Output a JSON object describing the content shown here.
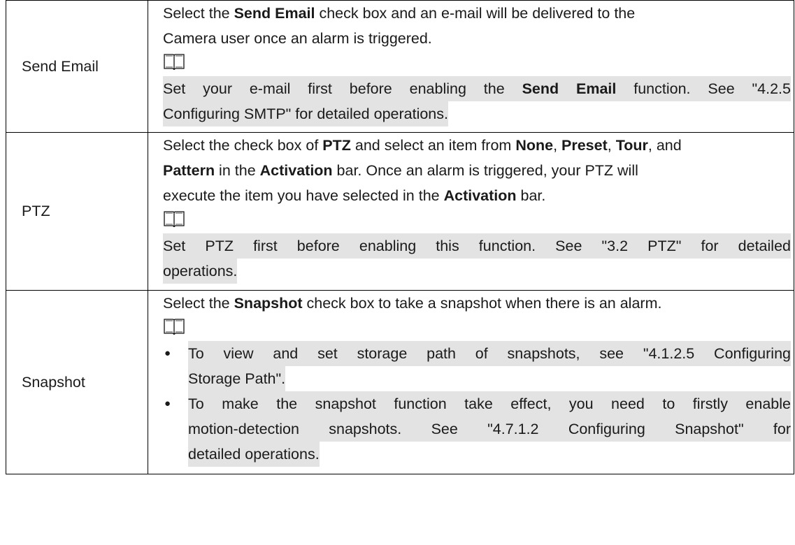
{
  "rows": [
    {
      "label": "Send Email",
      "desc_lines": [
        [
          "Select the ",
          {
            "b": "Send Email"
          },
          " check box and an e-mail will be delivered to the"
        ],
        [
          "Camera user once an alarm is triggered."
        ]
      ],
      "note_lines": [
        [
          "Set your e-mail first before enabling the ",
          {
            "b": "Send Email"
          },
          " function. See \"4.2.5"
        ],
        [
          "Configuring SMTP\" for detailed operations."
        ]
      ]
    },
    {
      "label": "PTZ",
      "desc_lines": [
        [
          "Select the check box of ",
          {
            "b": "PTZ"
          },
          " and select an item from ",
          {
            "b": "None"
          },
          ", ",
          {
            "b": "Preset"
          },
          ", ",
          {
            "b": "Tour"
          },
          ", and"
        ],
        [
          {
            "b": "Pattern"
          },
          " in the ",
          {
            "b": "Activation"
          },
          " bar. Once an alarm is triggered, your PTZ will"
        ],
        [
          "execute the item you have selected in the ",
          {
            "b": "Activation"
          },
          " bar."
        ]
      ],
      "note_lines": [
        [
          "Set PTZ first before enabling this function. See \"3.2 PTZ\" for detailed"
        ],
        [
          "operations."
        ]
      ]
    },
    {
      "label": "Snapshot",
      "desc_lines": [
        [
          "Select the ",
          {
            "b": "Snapshot"
          },
          " check box to take a snapshot when there is an alarm."
        ]
      ],
      "bullets": [
        [
          [
            "To view and set storage path of snapshots, see \"4.1.2.5 Configuring"
          ],
          [
            "Storage Path\"."
          ]
        ],
        [
          [
            "To make the snapshot function take effect, you need to firstly enable"
          ],
          [
            "motion-detection snapshots. See \"4.7.1.2 Configuring Snapshot\" for"
          ],
          [
            "detailed operations."
          ]
        ]
      ]
    }
  ],
  "icons": {
    "note": "book-note-icon",
    "bullet": "●"
  }
}
